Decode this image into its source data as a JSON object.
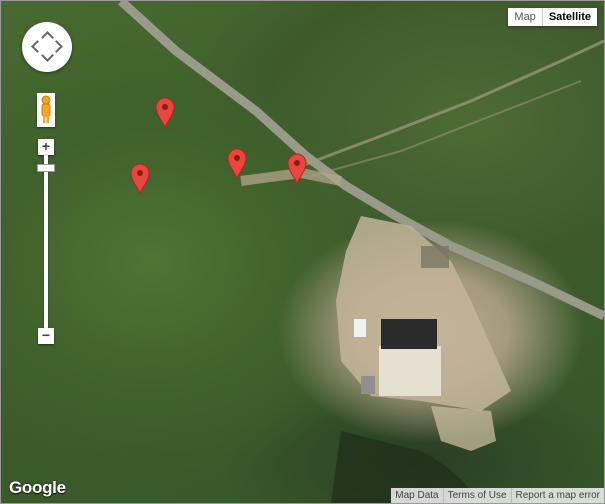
{
  "map": {
    "type_control": {
      "map_label": "Map",
      "satellite_label": "Satellite",
      "selected": "Satellite"
    },
    "logo_text": "Google",
    "footer": {
      "map_data": "Map Data",
      "terms": "Terms of Use",
      "report": "Report a map error"
    },
    "markers": [
      "marker",
      "marker",
      "marker",
      "marker"
    ],
    "colors": {
      "marker": "#e8473d",
      "pegman": "#f5a623"
    }
  }
}
